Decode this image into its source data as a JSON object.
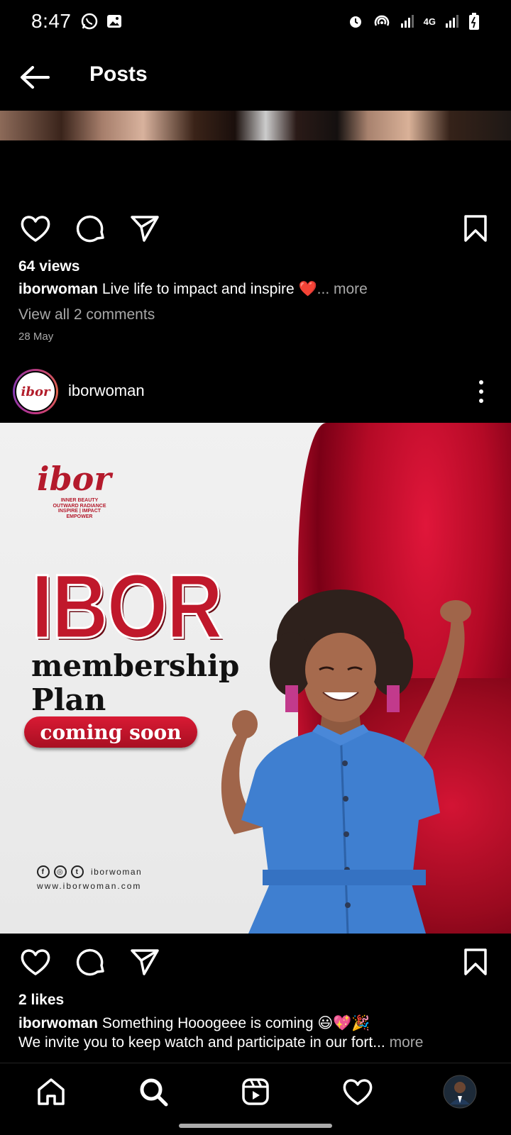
{
  "status_bar": {
    "time": "8:47",
    "network": "4G"
  },
  "header": {
    "title": "Posts"
  },
  "prev_post": {
    "views": "64 views",
    "username": "iborwoman",
    "caption": "Live life to impact and inspire ❤️",
    "more": "... more",
    "comments_link": "View all 2 comments",
    "date": "28 May"
  },
  "post": {
    "username": "iborwoman",
    "image": {
      "brand": "ibor",
      "brand_tagline": "INNER BEAUTY\nOUTWARD RADIANCE\nINSPIRE | IMPACT\nEMPOWER",
      "headline": "IBOR",
      "subline1": "membership",
      "subline2": "Plan",
      "badge": "coming soon",
      "social_handle": "iborwoman",
      "website": "www.iborwoman.com"
    },
    "likes": "2 likes",
    "caption_username": "iborwoman",
    "caption_line1": "Something Hooogeee is coming 😃💖🎉",
    "caption_line2": "We invite you to keep watch and participate in our fort...",
    "more": "more"
  },
  "colors": {
    "background": "#000000",
    "muted_text": "#a8a8a8",
    "brand_red": "#c0182b"
  }
}
